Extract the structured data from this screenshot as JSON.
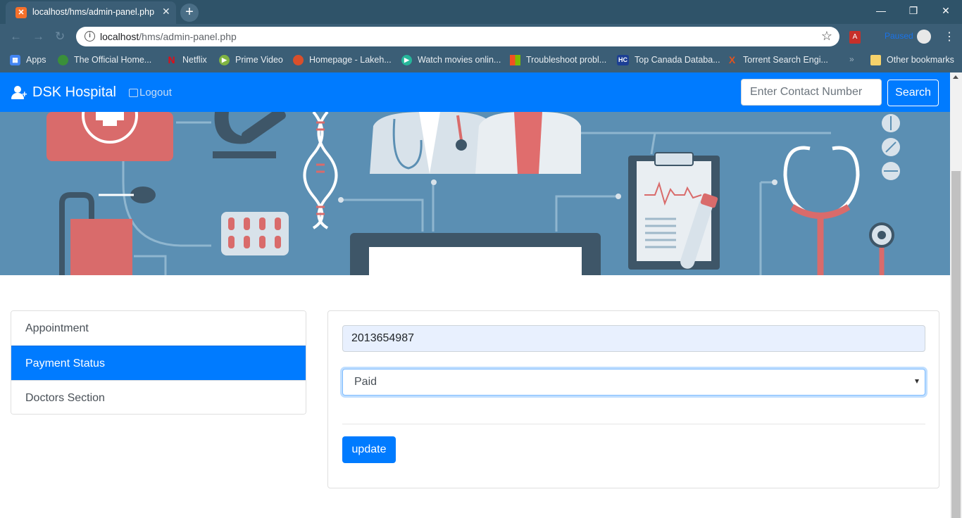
{
  "browser": {
    "tab_title": "localhost/hms/admin-panel.php",
    "url_host": "localhost",
    "url_path": "/hms/admin-panel.php",
    "profile_name": "Paused",
    "bookmarks": [
      {
        "label": "Apps",
        "icon": "apps-grid-icon",
        "color": "#4285f4"
      },
      {
        "label": "The Official Home...",
        "icon": "official-home-icon",
        "color": "#3a8f3a"
      },
      {
        "label": "Netflix",
        "icon": "netflix-icon",
        "color": "#e50914"
      },
      {
        "label": "Prime Video",
        "icon": "prime-video-icon",
        "color": "#7fb342"
      },
      {
        "label": "Homepage - Lakeh...",
        "icon": "lakehead-icon",
        "color": "#d94f2b"
      },
      {
        "label": "Watch movies onlin...",
        "icon": "watch-movies-icon",
        "color": "#26b69a"
      },
      {
        "label": "Troubleshoot probl...",
        "icon": "microsoft-icon",
        "color": "#f25022"
      },
      {
        "label": "Top Canada Databa...",
        "icon": "hc-icon",
        "color": "#1c3f94"
      },
      {
        "label": "Torrent Search Engi...",
        "icon": "torrent-icon",
        "color": "#e2531e"
      }
    ],
    "other_bookmarks": "Other bookmarks"
  },
  "navbar": {
    "brand": "DSK Hospital",
    "logout": "Logout",
    "search_placeholder": "Enter Contact Number",
    "search_button": "Search"
  },
  "sidebar": {
    "items": [
      {
        "label": "Appointment",
        "active": false
      },
      {
        "label": "Payment Status",
        "active": true
      },
      {
        "label": "Doctors Section",
        "active": false
      }
    ]
  },
  "payment_form": {
    "contact_value": "2013654987",
    "status_value": "Paid",
    "update_button": "update"
  },
  "colors": {
    "primary": "#007bff",
    "banner": "#5b8fb3"
  }
}
